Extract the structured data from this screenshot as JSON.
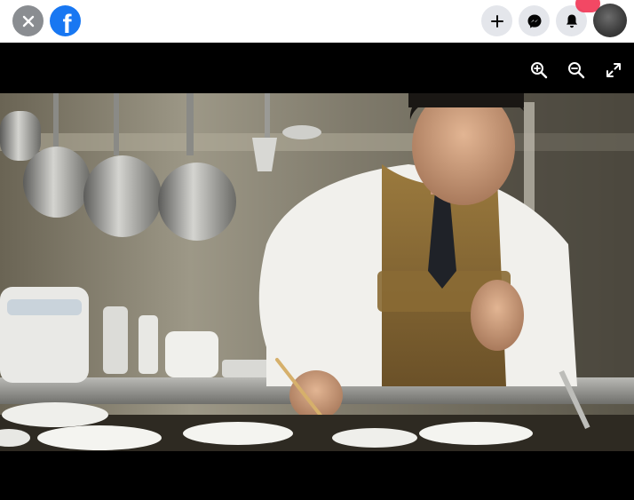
{
  "header": {
    "logo_letter": "f",
    "icons": {
      "close": "close-icon",
      "create": "plus-icon",
      "messenger": "messenger-icon",
      "notifications": "bell-icon"
    }
  },
  "viewer": {
    "tools": [
      "zoom-in-icon",
      "zoom-out-icon",
      "fullscreen-icon"
    ]
  },
  "colors": {
    "facebook_blue": "#1877f2",
    "notification_red": "#f02849",
    "button_gray": "#e4e6eb"
  }
}
